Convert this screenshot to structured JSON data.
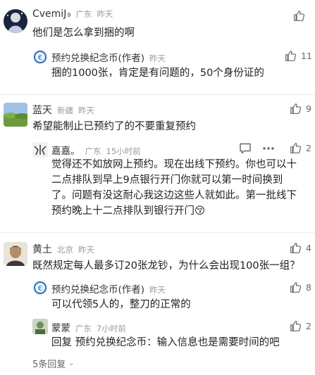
{
  "colors": {
    "text": "#222222",
    "meta": "#9a9a9a",
    "icon": "#666666",
    "divider": "#ececec"
  },
  "comments": [
    {
      "user": "CvemiJ",
      "vip_mark": "9",
      "location": "广东",
      "time": "昨天",
      "text": "他们是怎么拿到捆的啊",
      "likes": "",
      "replies": [
        {
          "user": "预约兑换纪念币(作者)",
          "time": "昨天",
          "text": "捆的1000张，肯定是有问题的，50个身份证的",
          "likes": "11"
        }
      ]
    },
    {
      "user": "蓝天",
      "location": "新疆",
      "time": "昨天",
      "text": "希望能制止已预约了的不要重复预约",
      "likes": "9",
      "replies": [
        {
          "user": "嘉嘉。",
          "location": "广东",
          "time": "15小时前",
          "lines": [
            "觉得还不如放网上预约。现在出线下预约。你也可以十",
            "二点排队到早上9点银行开门你就可以第一时间换到",
            "了。问题有没这耐心我这边这些人就如此。第一批线下",
            "预约晚上十二点排队到银行开门"
          ],
          "emoji": "😚",
          "likes": "2",
          "reply_icon": "comment-icon",
          "more_icon": "more-dots-icon"
        }
      ]
    },
    {
      "user": "黄土",
      "location": "北京",
      "time": "昨天",
      "text": "既然规定每人最多订20张龙钞，为什么会出现100张一组？",
      "likes": "4",
      "replies": [
        {
          "user": "预约兑换纪念币(作者)",
          "time": "昨天",
          "text": "可以代领5人的，整刀的正常的",
          "likes": "8"
        },
        {
          "user": "蒙蒙",
          "location": "广东",
          "time": "7小时前",
          "text": "回复 预约兑换纪念币：输入信息也是需要时间的吧",
          "likes": "2"
        }
      ],
      "more_replies": "5条回复"
    }
  ]
}
